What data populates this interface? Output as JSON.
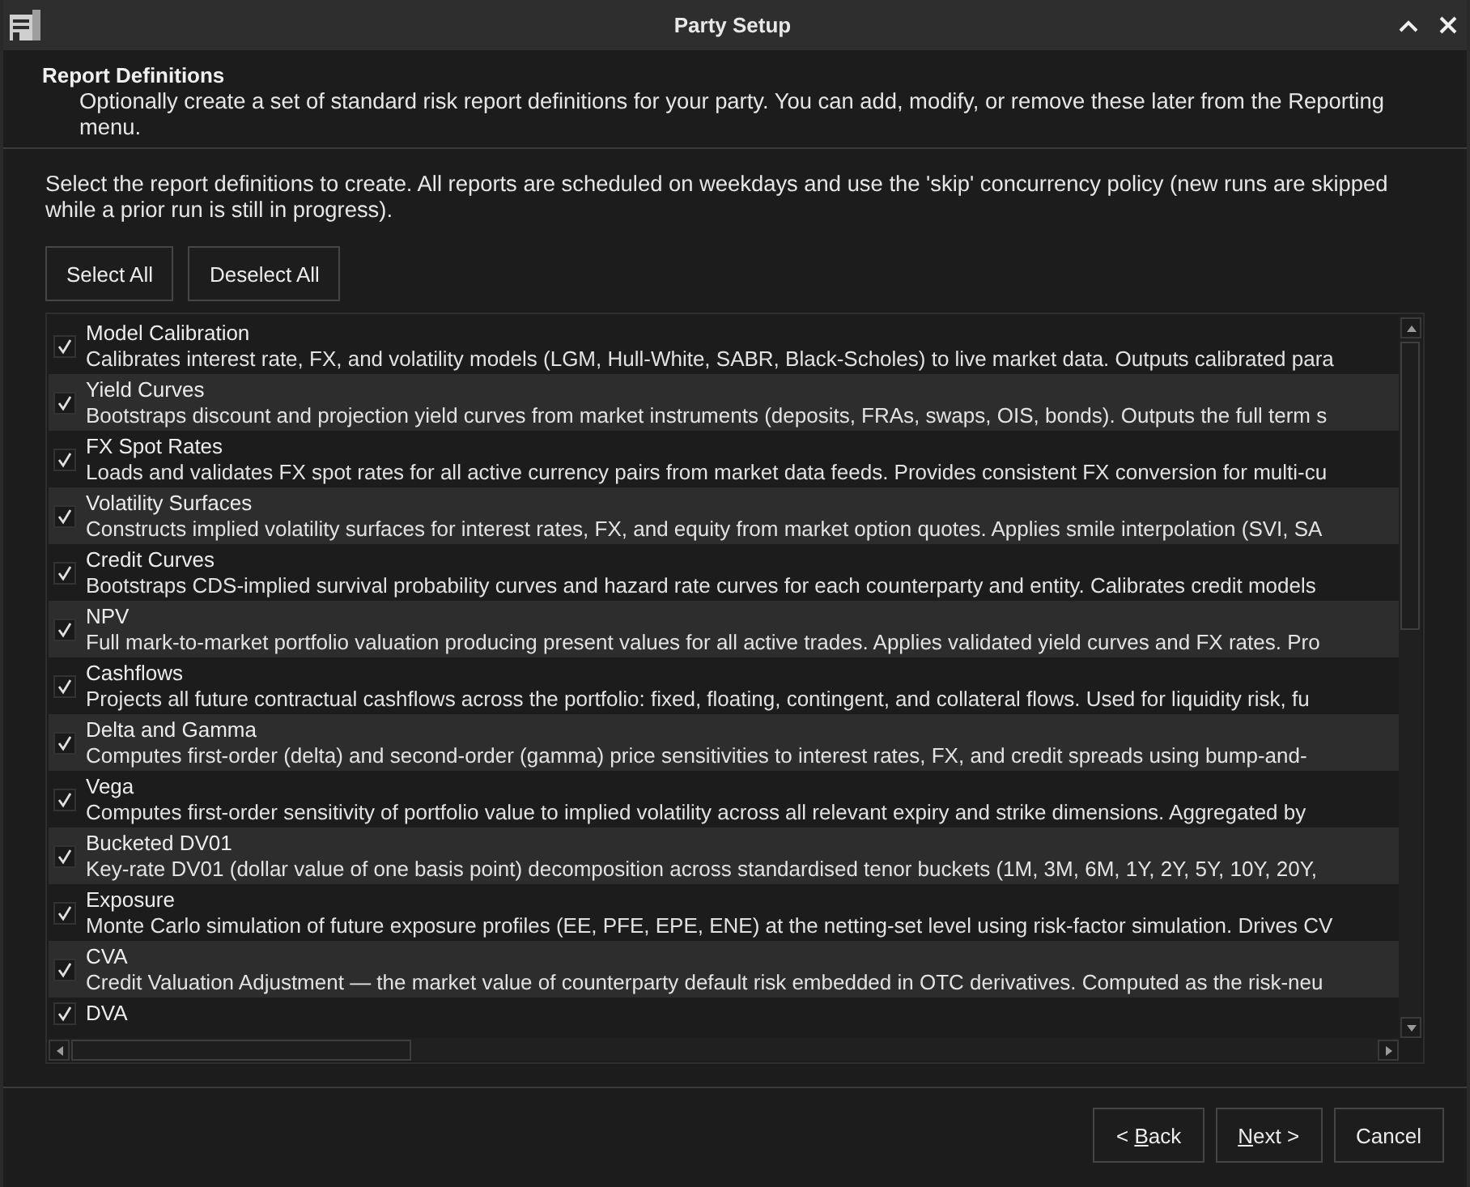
{
  "window": {
    "title": "Party Setup"
  },
  "header": {
    "title": "Report Definitions",
    "description": "Optionally create a set of standard risk report definitions for your party. You can add, modify, or remove these later from the Reporting menu."
  },
  "instructions": "Select the report definitions to create. All reports are scheduled on weekdays and use the 'skip' concurrency policy (new runs are skipped while a prior run is still in progress).",
  "selection_buttons": [
    {
      "label": "Select All"
    },
    {
      "label": "Deselect All"
    }
  ],
  "reports": [
    {
      "name": "Model Calibration",
      "description": "Calibrates interest rate, FX, and volatility models (LGM, Hull-White, SABR, Black-Scholes) to live market data. Outputs calibrated para",
      "checked": true
    },
    {
      "name": "Yield Curves",
      "description": "Bootstraps discount and projection yield curves from market instruments (deposits, FRAs, swaps, OIS, bonds). Outputs the full term s",
      "checked": true
    },
    {
      "name": "FX Spot Rates",
      "description": "Loads and validates FX spot rates for all active currency pairs from market data feeds. Provides consistent FX conversion for multi-cu",
      "checked": true
    },
    {
      "name": "Volatility Surfaces",
      "description": "Constructs implied volatility surfaces for interest rates, FX, and equity from market option quotes. Applies smile interpolation (SVI, SA",
      "checked": true
    },
    {
      "name": "Credit Curves",
      "description": "Bootstraps CDS-implied survival probability curves and hazard rate curves for each counterparty and entity. Calibrates credit models",
      "checked": true
    },
    {
      "name": "NPV",
      "description": "Full mark-to-market portfolio valuation producing present values for all active trades. Applies validated yield curves and FX rates. Pro",
      "checked": true
    },
    {
      "name": "Cashflows",
      "description": "Projects all future contractual cashflows across the portfolio: fixed, floating, contingent, and collateral flows. Used for liquidity risk, fu",
      "checked": true
    },
    {
      "name": "Delta and Gamma",
      "description": "Computes first-order (delta) and second-order (gamma) price sensitivities to interest rates, FX, and credit spreads using bump-and-",
      "checked": true
    },
    {
      "name": "Vega",
      "description": "Computes first-order sensitivity of portfolio value to implied volatility across all relevant expiry and strike dimensions. Aggregated by",
      "checked": true
    },
    {
      "name": "Bucketed DV01",
      "description": "Key-rate DV01 (dollar value of one basis point) decomposition across standardised tenor buckets (1M, 3M, 6M, 1Y, 2Y, 5Y, 10Y, 20Y,",
      "checked": true
    },
    {
      "name": "Exposure",
      "description": "Monte Carlo simulation of future exposure profiles (EE, PFE, EPE, ENE) at the netting-set level using risk-factor simulation. Drives CV",
      "checked": true
    },
    {
      "name": "CVA",
      "description": "Credit Valuation Adjustment — the market value of counterparty default risk embedded in OTC derivatives. Computed as the risk-neu",
      "checked": true
    },
    {
      "name": "DVA",
      "checked": true
    }
  ],
  "nav_buttons": [
    {
      "label_parts": [
        {
          "text": "< ",
          "underlined": false
        },
        {
          "text": "B",
          "underlined": true
        },
        {
          "text": "ack",
          "underlined": false
        }
      ]
    },
    {
      "label_parts": [
        {
          "text": "N",
          "underlined": true
        },
        {
          "text": "ext >",
          "underlined": false
        }
      ]
    },
    {
      "label_parts": [
        {
          "text": "Cancel",
          "underlined": false
        }
      ]
    }
  ]
}
